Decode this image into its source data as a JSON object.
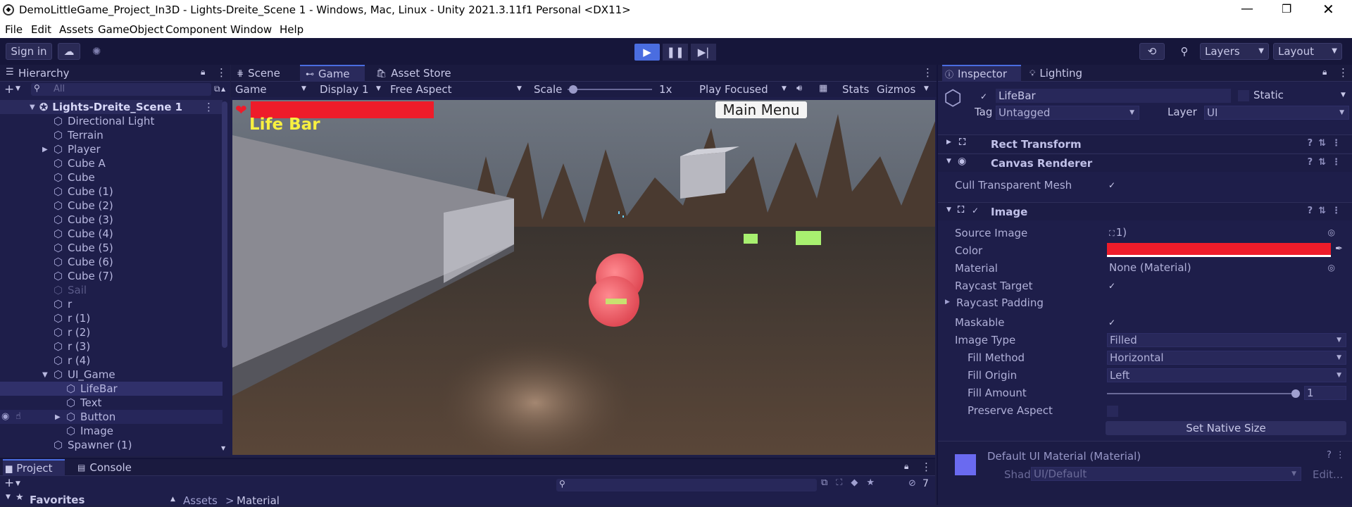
{
  "window": {
    "title": "DemoLittleGame_Project_In3D - Lights-Dreite_Scene 1 - Windows, Mac, Linux - Unity 2021.3.11f1 Personal <DX11>"
  },
  "menu": [
    "File",
    "Edit",
    "Assets",
    "GameObject",
    "Component",
    "Window",
    "Help"
  ],
  "toolbar": {
    "signin": "Sign in",
    "layers": "Layers",
    "layout": "Layout"
  },
  "hierarchy": {
    "title": "Hierarchy",
    "search_placeholder": "All",
    "scene": "Lights-Dreite_Scene 1",
    "items": [
      {
        "label": "Directional Light"
      },
      {
        "label": "Terrain"
      },
      {
        "label": "Player"
      },
      {
        "label": "Cube A"
      },
      {
        "label": "Cube"
      },
      {
        "label": "Cube (1)"
      },
      {
        "label": "Cube (2)"
      },
      {
        "label": "Cube (3)"
      },
      {
        "label": "Cube (4)"
      },
      {
        "label": "Cube (5)"
      },
      {
        "label": "Cube (6)"
      },
      {
        "label": "Cube (7)"
      },
      {
        "label": "Sail"
      },
      {
        "label": "r"
      },
      {
        "label": "r (1)"
      },
      {
        "label": "r (2)"
      },
      {
        "label": "r (3)"
      },
      {
        "label": "r (4)"
      },
      {
        "label": "UI_Game"
      },
      {
        "label": "LifeBar"
      },
      {
        "label": "Text"
      },
      {
        "label": "Button"
      },
      {
        "label": "Image"
      },
      {
        "label": "Spawner (1)"
      }
    ]
  },
  "center_tabs": {
    "scene": "Scene",
    "game": "Game",
    "asset_store": "Asset Store"
  },
  "game_bar": {
    "mode": "Game",
    "display": "Display 1",
    "aspect": "Free Aspect",
    "scale_label": "Scale",
    "scale_value": "1x",
    "play_mode": "Play Focused",
    "stats": "Stats",
    "gizmos": "Gizmos"
  },
  "game_view": {
    "life_bar_label": "Life Bar",
    "main_menu": "Main Menu"
  },
  "inspector": {
    "tab": "Inspector",
    "lighting_tab": "Lighting",
    "object_name": "LifeBar",
    "static_label": "Static",
    "tag_label": "Tag",
    "tag_value": "Untagged",
    "layer_label": "Layer",
    "layer_value": "UI",
    "rect_transform": "Rect Transform",
    "canvas_renderer": "Canvas Renderer",
    "cull_label": "Cull Transparent Mesh",
    "image": "Image",
    "source_image_label": "Source Image",
    "source_image_value": "1)",
    "color_label": "Color",
    "color_value": "#ee1c2a",
    "material_label": "Material",
    "material_value": "None (Material)",
    "raycast_target_label": "Raycast Target",
    "raycast_padding_label": "Raycast Padding",
    "maskable_label": "Maskable",
    "image_type_label": "Image Type",
    "image_type_value": "Filled",
    "fill_method_label": "Fill Method",
    "fill_method_value": "Horizontal",
    "fill_origin_label": "Fill Origin",
    "fill_origin_value": "Left",
    "fill_amount_label": "Fill Amount",
    "fill_amount_value": "1",
    "preserve_aspect_label": "Preserve Aspect",
    "set_native_size": "Set Native Size",
    "material_name": "Default UI Material (Material)",
    "shader_label": "Shader",
    "shader_value": "UI/Default",
    "edit_label": "Edit..."
  },
  "bottom": {
    "project_tab": "Project",
    "console_tab": "Console",
    "favorites": "Favorites",
    "breadcrumb_assets": "Assets",
    "breadcrumb_material": "Material",
    "hidden_count": "7"
  }
}
